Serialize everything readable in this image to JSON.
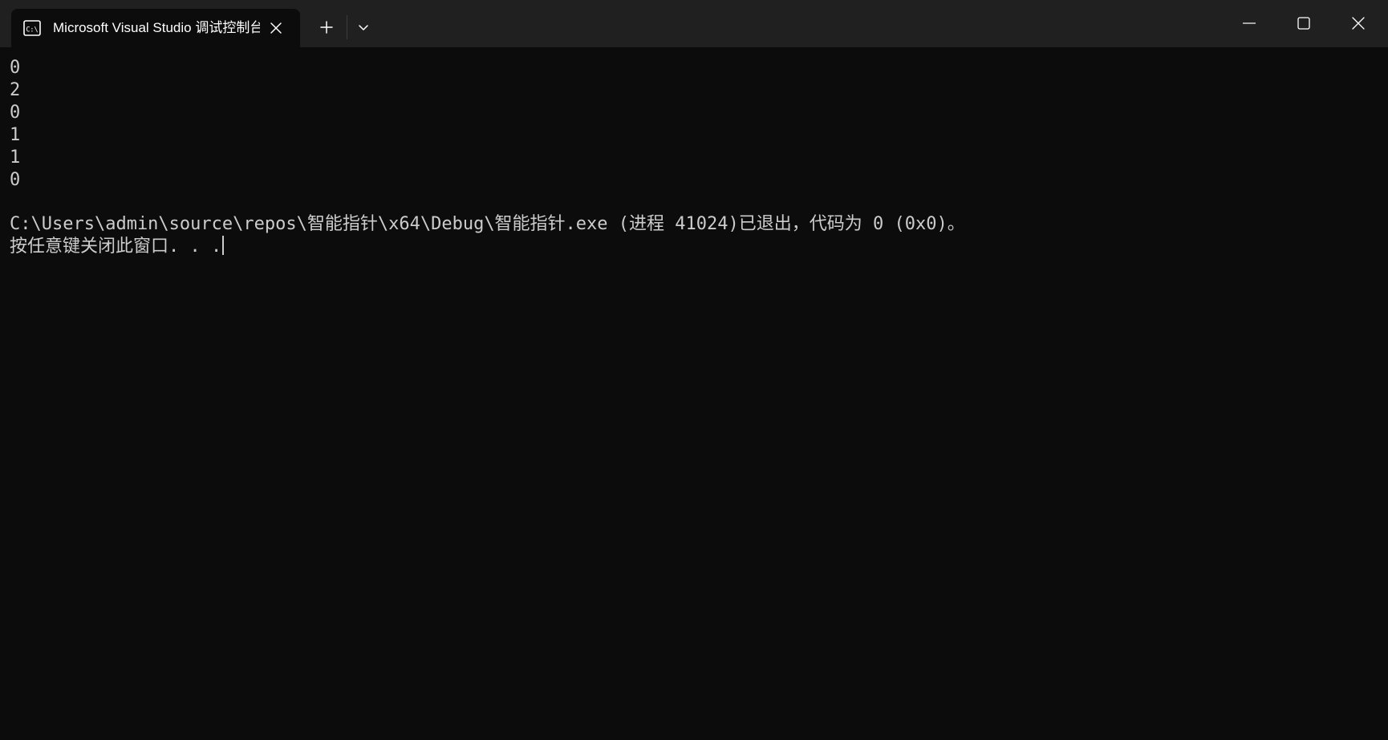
{
  "tab": {
    "icon": "console-icon",
    "icon_text": "C:\\",
    "title": "Microsoft Visual Studio 调试控制台"
  },
  "titlebar": {
    "new_tab_icon": "plus-icon",
    "dropdown_icon": "chevron-down-icon",
    "minimize_icon": "minimize-icon",
    "maximize_icon": "maximize-icon",
    "close_icon": "close-icon"
  },
  "console": {
    "output_lines": [
      "0",
      "2",
      "0",
      "1",
      "1",
      "0"
    ],
    "exit_message": "C:\\Users\\admin\\source\\repos\\智能指针\\x64\\Debug\\智能指针.exe (进程 41024)已退出，代码为 0 (0x0)。",
    "prompt": "按任意键关闭此窗口. . ."
  },
  "colors": {
    "titlebar_bg": "#202020",
    "console_bg": "#0c0c0c",
    "console_text": "#cccccc",
    "tab_text": "#ffffff"
  }
}
